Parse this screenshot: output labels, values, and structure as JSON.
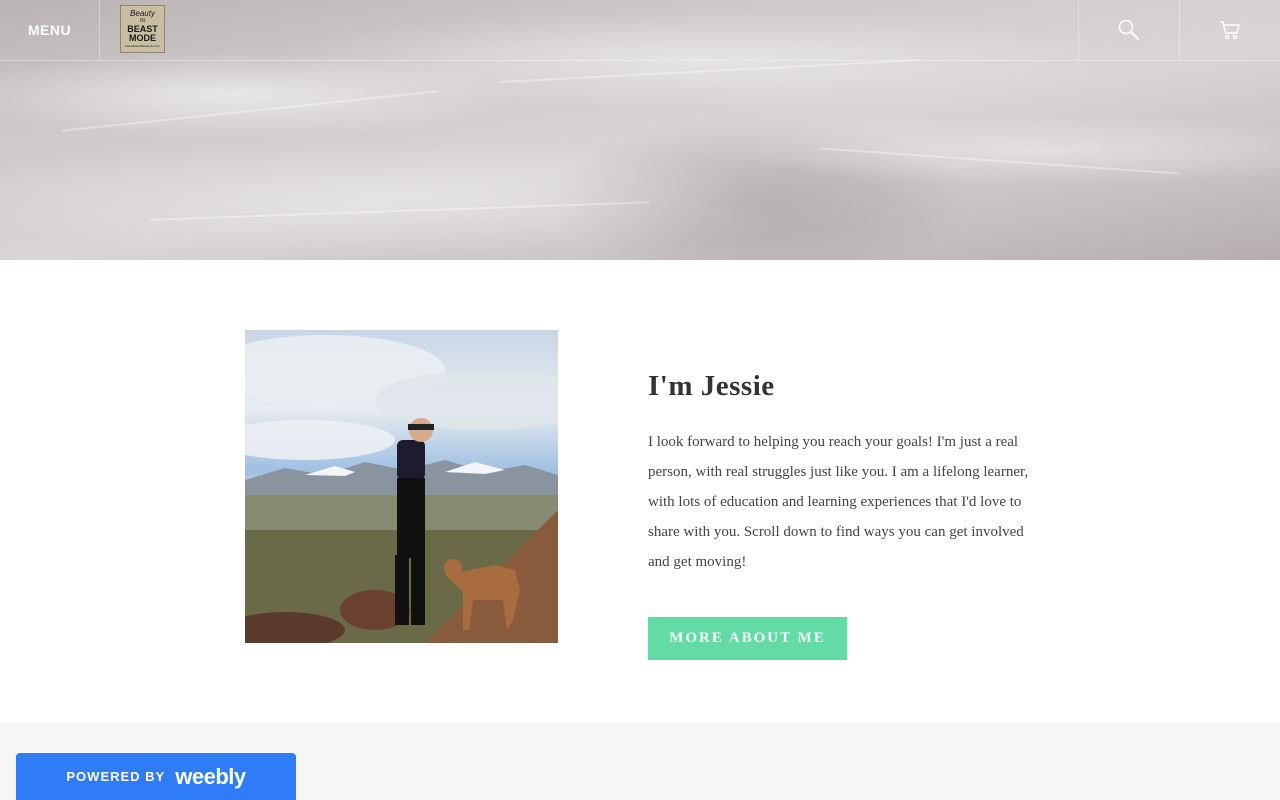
{
  "header": {
    "menu_label": "MENU",
    "logo": {
      "line1": "Beauty",
      "line2": "IN",
      "line3": "BEAST",
      "line4": "MODE",
      "line5": "www.BeautiBeastLife.com"
    },
    "search_icon": "search-icon",
    "cart_icon": "cart-icon"
  },
  "about": {
    "heading": "I'm Jessie",
    "paragraph": "I look forward to helping you reach your goals! I'm just a real person, with real struggles just like you. I am a lifelong learner, with lots of education and learning experiences that I'd love to share with you.  Scroll down to find ways you can get involved and get moving!",
    "button_label": "MORE ABOUT ME"
  },
  "footer": {
    "powered_by": "POWERED BY",
    "brand": "weebly"
  },
  "colors": {
    "accent": "#63dba4",
    "badge": "#2f7cf6",
    "text": "#333333"
  }
}
